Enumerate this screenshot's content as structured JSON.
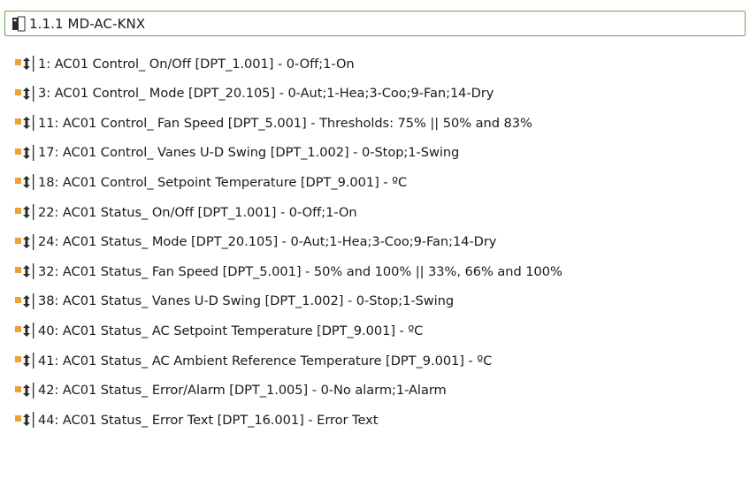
{
  "tree": {
    "root": {
      "label": "1.1.1  MD-AC-KNX",
      "icon": "knx-device-icon"
    },
    "items": [
      {
        "label": "1: AC01 Control_ On/Off [DPT_1.001] - 0-Off;1-On",
        "icon": "group-object-icon"
      },
      {
        "label": "3: AC01 Control_ Mode [DPT_20.105] - 0-Aut;1-Hea;3-Coo;9-Fan;14-Dry",
        "icon": "group-object-icon"
      },
      {
        "label": "11: AC01 Control_ Fan Speed [DPT_5.001] - Thresholds: 75% || 50% and 83%",
        "icon": "group-object-icon"
      },
      {
        "label": "17: AC01 Control_ Vanes U-D Swing [DPT_1.002] - 0-Stop;1-Swing",
        "icon": "group-object-icon"
      },
      {
        "label": "18: AC01 Control_ Setpoint Temperature [DPT_9.001] - ºC",
        "icon": "group-object-icon"
      },
      {
        "label": "22: AC01 Status_ On/Off [DPT_1.001] - 0-Off;1-On",
        "icon": "group-object-icon"
      },
      {
        "label": "24: AC01 Status_ Mode [DPT_20.105] - 0-Aut;1-Hea;3-Coo;9-Fan;14-Dry",
        "icon": "group-object-icon"
      },
      {
        "label": "32: AC01 Status_ Fan Speed [DPT_5.001] - 50% and 100% || 33%, 66% and 100%",
        "icon": "group-object-icon"
      },
      {
        "label": "38: AC01 Status_ Vanes U-D Swing [DPT_1.002] - 0-Stop;1-Swing",
        "icon": "group-object-icon"
      },
      {
        "label": "40: AC01 Status_ AC Setpoint Temperature [DPT_9.001] - ºC",
        "icon": "group-object-icon"
      },
      {
        "label": "41: AC01 Status_ AC Ambient Reference Temperature [DPT_9.001] - ºC",
        "icon": "group-object-icon"
      },
      {
        "label": "42: AC01 Status_ Error/Alarm [DPT_1.005] - 0-No alarm;1-Alarm",
        "icon": "group-object-icon"
      },
      {
        "label": "44: AC01 Status_ Error Text [DPT_16.001] - Error Text",
        "icon": "group-object-icon"
      }
    ]
  },
  "colors": {
    "selection_border": "#6aa84f",
    "icon_orange": "#e8a33a",
    "icon_dark": "#2b2b2b"
  }
}
